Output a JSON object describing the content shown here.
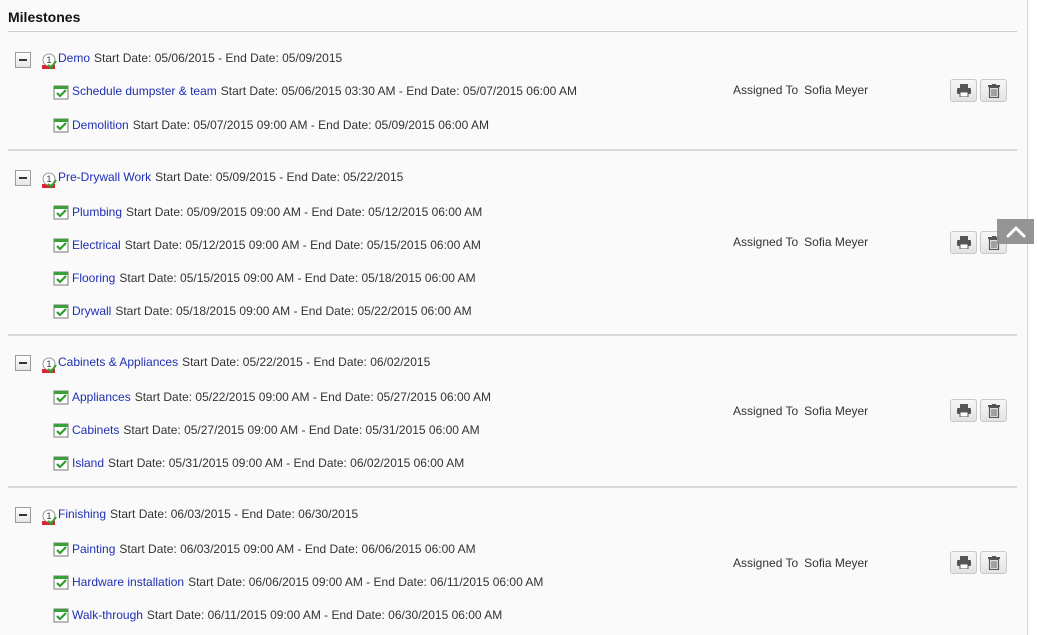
{
  "title": "Milestones",
  "groups": [
    {
      "name": "Demo",
      "dates": "Start Date: 05/06/2015 - End Date: 05/09/2015",
      "assigned_label": "Assigned To",
      "assigned_to": "Sofia Meyer",
      "tasks": [
        {
          "name": "Schedule dumpster & team",
          "dates": "Start Date: 05/06/2015 03:30 AM - End Date: 05/07/2015 06:00 AM"
        },
        {
          "name": "Demolition",
          "dates": "Start Date: 05/07/2015 09:00 AM - End Date: 05/09/2015 06:00 AM"
        }
      ]
    },
    {
      "name": "Pre-Drywall Work",
      "dates": "Start Date: 05/09/2015 - End Date: 05/22/2015",
      "assigned_label": "Assigned To",
      "assigned_to": "Sofia Meyer",
      "tasks": [
        {
          "name": "Plumbing",
          "dates": "Start Date: 05/09/2015 09:00 AM - End Date: 05/12/2015 06:00 AM"
        },
        {
          "name": "Electrical",
          "dates": "Start Date: 05/12/2015 09:00 AM - End Date: 05/15/2015 06:00 AM"
        },
        {
          "name": "Flooring",
          "dates": "Start Date: 05/15/2015 09:00 AM - End Date: 05/18/2015 06:00 AM"
        },
        {
          "name": "Drywall",
          "dates": "Start Date: 05/18/2015 09:00 AM - End Date: 05/22/2015 06:00 AM"
        }
      ]
    },
    {
      "name": "Cabinets & Appliances",
      "dates": "Start Date: 05/22/2015 - End Date: 06/02/2015",
      "assigned_label": "Assigned To",
      "assigned_to": "Sofia Meyer",
      "tasks": [
        {
          "name": "Appliances",
          "dates": "Start Date: 05/22/2015 09:00 AM - End Date: 05/27/2015 06:00 AM"
        },
        {
          "name": "Cabinets",
          "dates": "Start Date: 05/27/2015 09:00 AM - End Date: 05/31/2015 06:00 AM"
        },
        {
          "name": "Island",
          "dates": "Start Date: 05/31/2015 09:00 AM - End Date: 06/02/2015 06:00 AM"
        }
      ]
    },
    {
      "name": "Finishing",
      "dates": "Start Date: 06/03/2015 - End Date: 06/30/2015",
      "assigned_label": "Assigned To",
      "assigned_to": "Sofia Meyer",
      "tasks": [
        {
          "name": "Painting",
          "dates": "Start Date: 06/03/2015 09:00 AM - End Date: 06/06/2015 06:00 AM"
        },
        {
          "name": "Hardware installation",
          "dates": "Start Date: 06/06/2015 09:00 AM - End Date: 06/11/2015 06:00 AM"
        },
        {
          "name": "Walk-through",
          "dates": "Start Date: 06/11/2015 09:00 AM - End Date: 06/30/2015 06:00 AM"
        }
      ]
    }
  ]
}
